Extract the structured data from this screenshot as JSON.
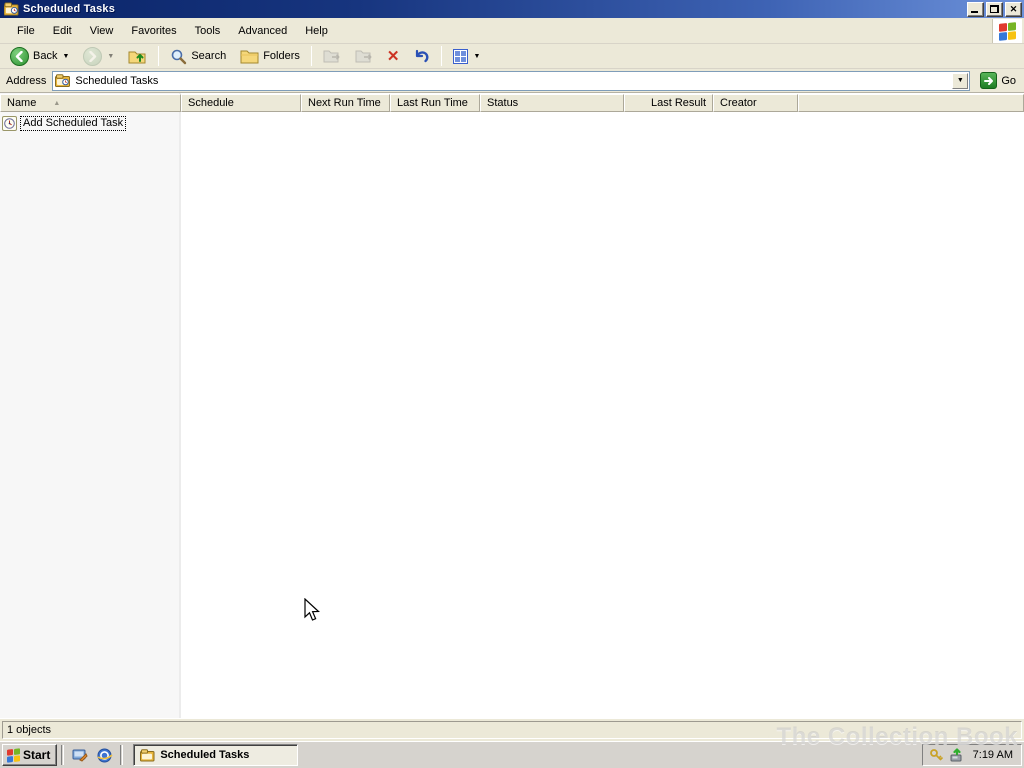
{
  "window": {
    "title": "Scheduled Tasks"
  },
  "menu": {
    "items": [
      "File",
      "Edit",
      "View",
      "Favorites",
      "Tools",
      "Advanced",
      "Help"
    ]
  },
  "toolbar": {
    "back_label": "Back",
    "search_label": "Search",
    "folders_label": "Folders"
  },
  "address": {
    "label": "Address",
    "value": "Scheduled Tasks",
    "go_label": "Go"
  },
  "list": {
    "columns": [
      {
        "label": "Name",
        "sorted_ascending": true
      },
      {
        "label": "Schedule"
      },
      {
        "label": "Next Run Time"
      },
      {
        "label": "Last Run Time"
      },
      {
        "label": "Status"
      },
      {
        "label": "Last Result"
      },
      {
        "label": "Creator"
      }
    ],
    "rows": [
      {
        "name": "Add Scheduled Task"
      }
    ]
  },
  "status": {
    "text": "1 objects"
  },
  "taskbar": {
    "start_label": "Start",
    "task_label": "Scheduled Tasks",
    "clock": "7:19 AM"
  },
  "watermark": {
    "text": "The Collection Book"
  },
  "icons": {
    "close": "✕",
    "delete": "✕",
    "dropdown": "▼",
    "sort_asc": "▲",
    "go_arrow": "➜",
    "back_arrow": "➜"
  },
  "colors": {
    "title_gradient_start": "#0a2468",
    "title_gradient_end": "#6d92da",
    "chrome": "#ECE9D8",
    "taskbar": "#d6d3ce",
    "go_green": "#2fa12f",
    "delete_red": "#cc3322"
  }
}
